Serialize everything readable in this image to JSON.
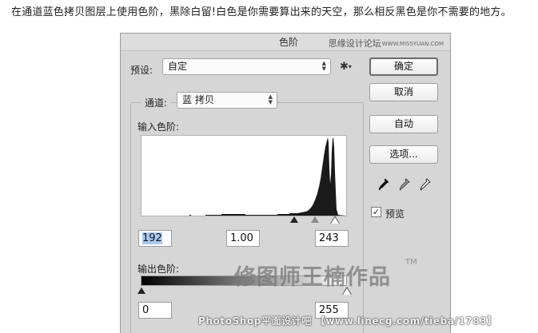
{
  "caption": "在通道蓝色拷贝图层上使用色阶，黑除白留!白色是你需要算出来的天空，那么相反黑色是你不需要的地方。",
  "dialog": {
    "title": "色阶",
    "watermark_top": "思缘设计论坛",
    "watermark_top_small": "WWW.MISSYUAN.COM",
    "preset_label": "预设:",
    "preset_value": "自定",
    "channel_label": "通道:",
    "channel_value": "蓝 拷贝",
    "input_levels_label": "输入色阶:",
    "input_black": "192",
    "input_gamma": "1.00",
    "input_white": "243",
    "output_levels_label": "输出色阶:",
    "output_black": "0",
    "output_white": "255",
    "buttons": {
      "ok": "确定",
      "cancel": "取消",
      "auto": "自动",
      "options": "选项..."
    },
    "preview_label": "预览",
    "preview_checked": true
  },
  "watermark_center": "修图师王楠作品",
  "watermark_tm": "TM",
  "watermark_bottom": "PhotoShop平面设计吧 【www.linecg.com/tieba/1783】",
  "icons": {
    "gear": "gear-icon",
    "black_eyedropper": "black-eyedropper-icon",
    "gray_eyedropper": "gray-eyedropper-icon",
    "white_eyedropper": "white-eyedropper-icon"
  }
}
